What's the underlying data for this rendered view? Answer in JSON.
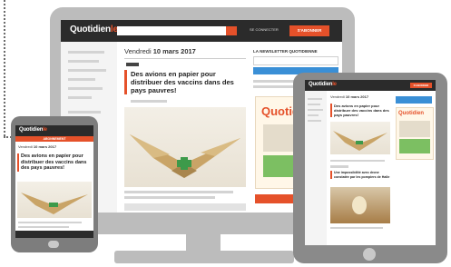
{
  "site": {
    "logo_main": "Quotidien",
    "logo_suffix": "le",
    "subscribe_label": "S'ABONNER",
    "login_label": "SE CONNECTER"
  },
  "article": {
    "date_prefix": "Vendredi",
    "date_bold": "10 mars 2017",
    "headline": "Des avions en papier pour distribuer des vaccins dans des pays pauvres!"
  },
  "newsletter": {
    "title": "LA NEWSLETTER QUOTIDIENNE"
  },
  "phone": {
    "edition_label": "ABONNEMENT"
  },
  "tablet": {
    "second_headline": "Une impossibilité avec drone constatée par les pompiers de Halle"
  },
  "colors": {
    "accent": "#e5512a",
    "device_gray": "#bcbcbc",
    "header_dark": "#2b2b2b"
  }
}
